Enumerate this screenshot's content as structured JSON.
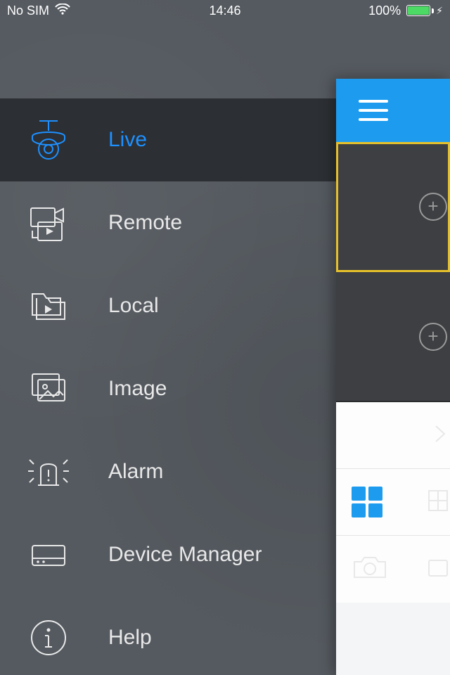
{
  "status": {
    "carrier": "No SIM",
    "time": "14:46",
    "battery_pct": "100%"
  },
  "menu": {
    "items": [
      {
        "label": "Live"
      },
      {
        "label": "Remote"
      },
      {
        "label": "Local"
      },
      {
        "label": "Image"
      },
      {
        "label": "Alarm"
      },
      {
        "label": "Device Manager"
      },
      {
        "label": "Help"
      }
    ]
  },
  "right_panel": {
    "cells_visible": 2
  },
  "colors": {
    "accent": "#1d9cef",
    "active_text": "#1e90ff",
    "selection": "#e6c02a"
  }
}
